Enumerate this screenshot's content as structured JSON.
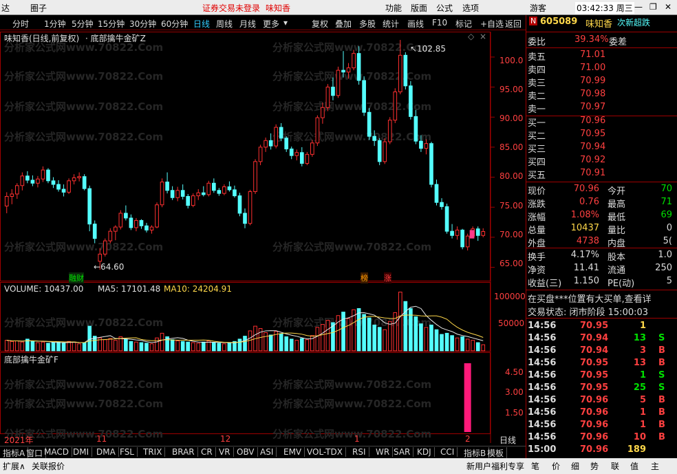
{
  "topbar": {
    "app_fragment": "达",
    "circle": "圈子",
    "login_notice": "证券交易未登录",
    "stock_name": "味知香",
    "menu": [
      "功能",
      "版面",
      "公式",
      "选项"
    ],
    "guest": "游客",
    "clock": "03:42:33 周三",
    "colors": {
      "notice": "#ff0000"
    }
  },
  "toolbar": {
    "periods": [
      "分时",
      "1分钟",
      "5分钟",
      "15分钟",
      "30分钟",
      "60分钟",
      "日线",
      "周线",
      "月线",
      "更多"
    ],
    "active_period": "日线",
    "tools": [
      "复权",
      "叠加",
      "多股",
      "统计",
      "画线",
      "F10",
      "标记",
      "+自选",
      "返回"
    ]
  },
  "chart_title": {
    "name": "味知香(日线,前复权)",
    "indicator": "底部擒牛金矿Z"
  },
  "price_axis": [
    "100.0",
    "95.00",
    "90.00",
    "85.00",
    "80.00",
    "75.00",
    "70.00",
    "65.00"
  ],
  "price_annotations": {
    "high": "102.85",
    "low": "64.60"
  },
  "markers": {
    "finance": "融财",
    "rank": "榜",
    "rise": "涨"
  },
  "volume_title": {
    "volume": "VOLUME: 10437.00",
    "ma5": "MA5: 17101.48",
    "ma10": "MA10: 24204.91"
  },
  "volume_axis": [
    "100000",
    "50000"
  ],
  "indicator_title": "底部擒牛金矿F",
  "indicator_axis": [
    "4.50",
    "3.00",
    "1.50"
  ],
  "time_axis": [
    "2021年",
    "11",
    "12",
    "1",
    "2"
  ],
  "period_label": "日线",
  "watermark": "分析家公式网www.70822.Com",
  "chart_data": {
    "type": "candlestick",
    "ylim": [
      63,
      104
    ],
    "candles": [
      [
        75.2,
        77.5,
        74.0,
        76.8
      ],
      [
        76.8,
        78.0,
        75.5,
        77.2
      ],
      [
        77.2,
        79.0,
        76.4,
        78.6
      ],
      [
        78.6,
        80.8,
        77.8,
        80.2
      ],
      [
        80.2,
        81.0,
        79.0,
        79.5
      ],
      [
        79.5,
        80.3,
        78.5,
        79.0
      ],
      [
        79.0,
        80.2,
        78.3,
        79.7
      ],
      [
        79.7,
        81.8,
        79.2,
        81.2
      ],
      [
        81.2,
        81.5,
        79.0,
        79.4
      ],
      [
        79.4,
        80.0,
        78.2,
        78.8
      ],
      [
        78.8,
        79.5,
        77.6,
        78.0
      ],
      [
        78.0,
        78.8,
        76.8,
        77.5
      ],
      [
        77.5,
        79.8,
        77.2,
        79.4
      ],
      [
        79.4,
        80.5,
        78.8,
        79.9
      ],
      [
        79.9,
        80.8,
        79.3,
        80.1
      ],
      [
        80.1,
        80.5,
        77.8,
        78.1
      ],
      [
        78.1,
        78.6,
        71.0,
        72.2
      ],
      [
        72.2,
        72.8,
        69.0,
        69.8
      ],
      [
        66.0,
        68.2,
        64.6,
        67.2
      ],
      [
        67.2,
        69.8,
        66.8,
        69.4
      ],
      [
        69.4,
        71.5,
        69.0,
        71.0
      ],
      [
        71.0,
        72.0,
        69.5,
        71.7
      ],
      [
        71.7,
        74.5,
        71.3,
        74.0
      ],
      [
        74.0,
        75.3,
        72.8,
        73.2
      ],
      [
        73.2,
        73.8,
        71.2,
        71.6
      ],
      [
        71.6,
        73.2,
        71.0,
        72.8
      ],
      [
        72.8,
        73.0,
        71.4,
        71.9
      ],
      [
        71.9,
        72.4,
        70.8,
        71.2
      ],
      [
        71.2,
        72.0,
        70.6,
        71.7
      ],
      [
        71.7,
        75.8,
        71.5,
        75.4
      ],
      [
        75.4,
        79.8,
        75.0,
        79.2
      ],
      [
        79.2,
        80.8,
        77.3,
        77.8
      ],
      [
        77.8,
        78.5,
        76.2,
        76.6
      ],
      [
        76.6,
        78.4,
        76.0,
        77.8
      ],
      [
        77.8,
        78.8,
        76.3,
        76.8
      ],
      [
        76.8,
        77.2,
        74.8,
        75.3
      ],
      [
        75.3,
        77.3,
        75.0,
        76.9
      ],
      [
        76.9,
        78.0,
        76.2,
        77.4
      ],
      [
        77.4,
        78.5,
        76.8,
        77.1
      ],
      [
        77.1,
        79.4,
        76.8,
        79.0
      ],
      [
        79.0,
        79.8,
        77.4,
        77.8
      ],
      [
        77.8,
        78.2,
        76.9,
        77.3
      ],
      [
        77.3,
        78.8,
        77.0,
        78.4
      ],
      [
        78.4,
        79.3,
        77.6,
        77.9
      ],
      [
        77.9,
        78.6,
        76.6,
        76.9
      ],
      [
        76.9,
        77.4,
        73.5,
        74.0
      ],
      [
        74.0,
        74.8,
        71.5,
        72.3
      ],
      [
        72.3,
        77.9,
        72.0,
        77.6
      ],
      [
        77.6,
        83.0,
        77.2,
        82.6
      ],
      [
        82.6,
        85.4,
        82.0,
        85.0
      ],
      [
        85.0,
        86.6,
        84.2,
        86.1
      ],
      [
        86.1,
        87.3,
        84.6,
        85.2
      ],
      [
        85.2,
        88.8,
        84.8,
        88.3
      ],
      [
        88.3,
        89.0,
        86.0,
        86.5
      ],
      [
        86.5,
        86.8,
        84.2,
        84.7
      ],
      [
        84.7,
        85.1,
        83.0,
        83.6
      ],
      [
        83.6,
        84.6,
        82.8,
        84.1
      ],
      [
        84.1,
        85.0,
        81.8,
        82.3
      ],
      [
        82.3,
        84.2,
        82.0,
        83.8
      ],
      [
        83.8,
        86.2,
        83.4,
        85.7
      ],
      [
        85.7,
        90.3,
        85.2,
        89.9
      ],
      [
        89.9,
        92.4,
        88.9,
        91.6
      ],
      [
        91.6,
        95.5,
        91.0,
        95.0
      ],
      [
        95.0,
        96.6,
        92.8,
        93.6
      ],
      [
        93.6,
        98.4,
        93.2,
        97.8
      ],
      [
        97.8,
        101.0,
        96.6,
        97.5
      ],
      [
        97.5,
        99.0,
        96.4,
        98.2
      ],
      [
        98.2,
        101.2,
        97.8,
        100.6
      ],
      [
        100.6,
        101.8,
        95.4,
        96.1
      ],
      [
        96.1,
        96.8,
        90.2,
        90.8
      ],
      [
        90.8,
        91.5,
        86.2,
        86.8
      ],
      [
        86.8,
        87.8,
        85.2,
        86.1
      ],
      [
        86.1,
        86.5,
        82.0,
        82.6
      ],
      [
        82.6,
        86.5,
        82.2,
        85.9
      ],
      [
        85.9,
        90.0,
        85.5,
        89.5
      ],
      [
        89.5,
        94.8,
        89.0,
        94.2
      ],
      [
        94.2,
        102.85,
        93.8,
        100.3
      ],
      [
        100.3,
        100.8,
        94.6,
        95.2
      ],
      [
        95.2,
        96.0,
        89.6,
        90.1
      ],
      [
        90.1,
        91.2,
        85.5,
        86.0
      ],
      [
        86.0,
        87.0,
        84.2,
        84.8
      ],
      [
        84.8,
        86.3,
        83.8,
        85.6
      ],
      [
        85.6,
        85.9,
        78.3,
        78.8
      ],
      [
        78.8,
        79.6,
        75.3,
        75.8
      ],
      [
        75.8,
        76.5,
        74.6,
        75.1
      ],
      [
        75.1,
        75.6,
        70.6,
        71.0
      ],
      [
        71.0,
        72.2,
        69.8,
        70.3
      ],
      [
        70.3,
        71.8,
        69.6,
        71.2
      ],
      [
        71.2,
        71.4,
        68.0,
        68.4
      ],
      [
        68.4,
        70.6,
        67.8,
        70.2
      ],
      [
        70.2,
        71.8,
        69.8,
        71.4
      ],
      [
        71.4,
        71.8,
        69.4,
        70.3
      ],
      [
        70.3,
        71.5,
        70.0,
        70.96
      ]
    ],
    "volume": [
      18000,
      16000,
      17000,
      15000,
      20000,
      17000,
      14000,
      15000,
      13000,
      14000,
      15000,
      13000,
      16000,
      15000,
      12000,
      14000,
      42000,
      25000,
      22000,
      19000,
      21000,
      18000,
      24000,
      20000,
      16000,
      15000,
      14000,
      13000,
      12000,
      22000,
      30000,
      24000,
      19000,
      17000,
      16000,
      15000,
      14000,
      13000,
      15000,
      17000,
      14000,
      13000,
      12000,
      14000,
      16000,
      20000,
      25000,
      34000,
      42000,
      38000,
      31000,
      27000,
      33000,
      29000,
      24000,
      20000,
      18000,
      21000,
      19000,
      26000,
      40000,
      45000,
      52000,
      48000,
      60000,
      66000,
      55000,
      70000,
      72000,
      62000,
      56000,
      44000,
      40000,
      36000,
      50000,
      65000,
      100000,
      84000,
      72000,
      58000,
      46000,
      40000,
      44000,
      36000,
      28000,
      30000,
      26000,
      22000,
      24000,
      20000,
      18000,
      14000,
      10437
    ],
    "volume_ylim": [
      0,
      110000
    ],
    "indicator": {
      "name": "底部擒牛金矿F",
      "bar_index": 89,
      "value": 5.0,
      "ylim": [
        0,
        5.6
      ]
    }
  },
  "right_panel": {
    "code": "605089",
    "name": "味知香",
    "flag": "N",
    "ticker_notice": "次新超跌",
    "weibi": {
      "label": "委比",
      "value": "39.34%",
      "label2": "委差"
    },
    "sell": [
      {
        "label": "卖五",
        "price": "71.01"
      },
      {
        "label": "卖四",
        "price": "71.00"
      },
      {
        "label": "卖三",
        "price": "70.99"
      },
      {
        "label": "卖二",
        "price": "70.98"
      },
      {
        "label": "卖一",
        "price": "70.97"
      }
    ],
    "buy": [
      {
        "label": "买一",
        "price": "70.96"
      },
      {
        "label": "买二",
        "price": "70.95"
      },
      {
        "label": "买三",
        "price": "70.94"
      },
      {
        "label": "买四",
        "price": "70.92"
      },
      {
        "label": "买五",
        "price": "70.91"
      }
    ],
    "stats": [
      {
        "l1": "现价",
        "v1": "70.96",
        "l2": "今开",
        "v2": "70"
      },
      {
        "l1": "涨跌",
        "v1": "0.76",
        "l2": "最高",
        "v2": "71"
      },
      {
        "l1": "涨幅",
        "v1": "1.08%",
        "l2": "最低",
        "v2": "69"
      },
      {
        "l1": "总量",
        "v1": "10437",
        "l2": "量比",
        "v2": "0"
      },
      {
        "l1": "外盘",
        "v1": "4738",
        "l2": "内盘",
        "v2": "5("
      }
    ],
    "stats2": [
      {
        "l1": "换手",
        "v1": "4.17%",
        "l2": "股本",
        "v2": "1.0"
      },
      {
        "l1": "净资",
        "v1": "11.41",
        "l2": "流通",
        "v2": "250"
      },
      {
        "l1": "收益(三)",
        "v1": "1.150",
        "l2": "PE(动)",
        "v2": "5"
      }
    ],
    "notice": "在买盘***位置有大买单,查看详",
    "trade_status": "交易状态: 闭市阶段 15:00:03",
    "ticks": [
      {
        "time": "14:56",
        "price": "70.95",
        "vol": "1",
        "side": ""
      },
      {
        "time": "14:56",
        "price": "70.94",
        "vol": "13",
        "side": "S"
      },
      {
        "time": "14:56",
        "price": "70.94",
        "vol": "3",
        "side": "B"
      },
      {
        "time": "14:56",
        "price": "70.95",
        "vol": "13",
        "side": "B"
      },
      {
        "time": "14:56",
        "price": "70.95",
        "vol": "1",
        "side": "S"
      },
      {
        "time": "14:56",
        "price": "70.95",
        "vol": "25",
        "side": "S"
      },
      {
        "time": "14:56",
        "price": "70.96",
        "vol": "5",
        "side": "B"
      },
      {
        "time": "14:56",
        "price": "70.96",
        "vol": "1",
        "side": "B"
      },
      {
        "time": "14:56",
        "price": "70.96",
        "vol": "1",
        "side": "B"
      },
      {
        "time": "14:56",
        "price": "70.96",
        "vol": "10",
        "side": "B"
      },
      {
        "time": "15:00",
        "price": "70.96",
        "vol": "189",
        "side": ""
      }
    ]
  },
  "indicator_tabs": [
    "指标A",
    "窗口",
    "MACD",
    "DMI",
    "DMA",
    "FSL",
    "TRIX",
    "BRAR",
    "CR",
    "VR",
    "OBV",
    "ASI",
    "EMV",
    "VOL-TDX",
    "RSI",
    "WR",
    "SAR",
    "KDJ",
    "CCI",
    "指标B",
    "模板"
  ],
  "bottom_bar": {
    "left": [
      "扩展∧",
      "关联报价"
    ],
    "ad": "新用户福利专享",
    "right_tabs": [
      "笔",
      "价",
      "细",
      "势",
      "联",
      "值",
      "主"
    ]
  }
}
